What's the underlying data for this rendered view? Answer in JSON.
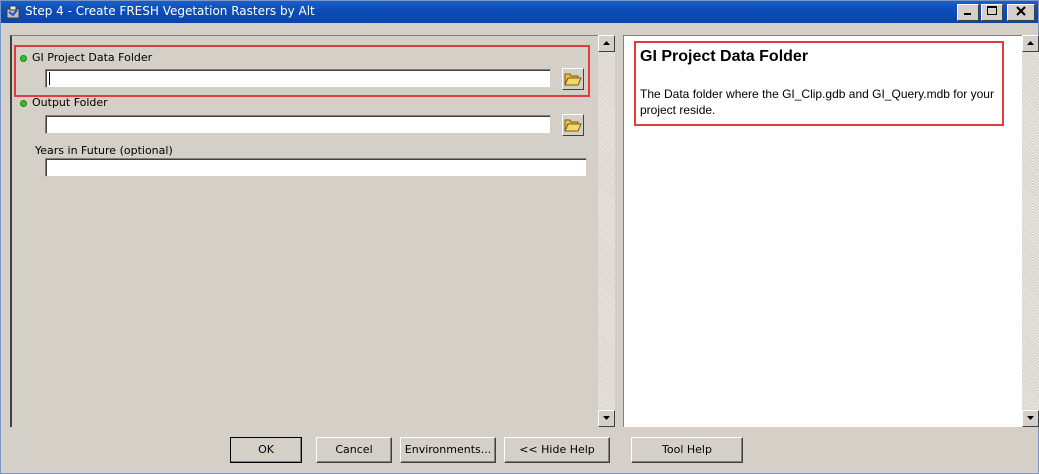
{
  "window": {
    "title": "Step 4 - Create FRESH Vegetation Rasters by Alt",
    "controls": {
      "minimize": "_",
      "maximize": "□",
      "close": "x"
    }
  },
  "parameters": [
    {
      "label": "GI Project Data Folder",
      "value": "",
      "required": true,
      "has_browse": true,
      "icon": "folder-open-icon"
    },
    {
      "label": "Output Folder",
      "value": "",
      "required": true,
      "has_browse": true,
      "icon": "folder-open-icon"
    },
    {
      "label": "Years in Future (optional)",
      "value": "",
      "required": false,
      "has_browse": false
    }
  ],
  "help": {
    "title": "GI Project Data Folder",
    "description": "The Data folder where the GI_Clip.gdb and GI_Query.mdb for your project reside."
  },
  "buttons": {
    "ok": "OK",
    "cancel": "Cancel",
    "environments": "Environments...",
    "hide_help": "<< Hide Help",
    "tool_help": "Tool Help"
  },
  "colors": {
    "titlebar": "#0b4cb8",
    "dialog_bg": "#d4d0c8",
    "required_dot": "#29c229",
    "highlight": "#e03c3c"
  }
}
